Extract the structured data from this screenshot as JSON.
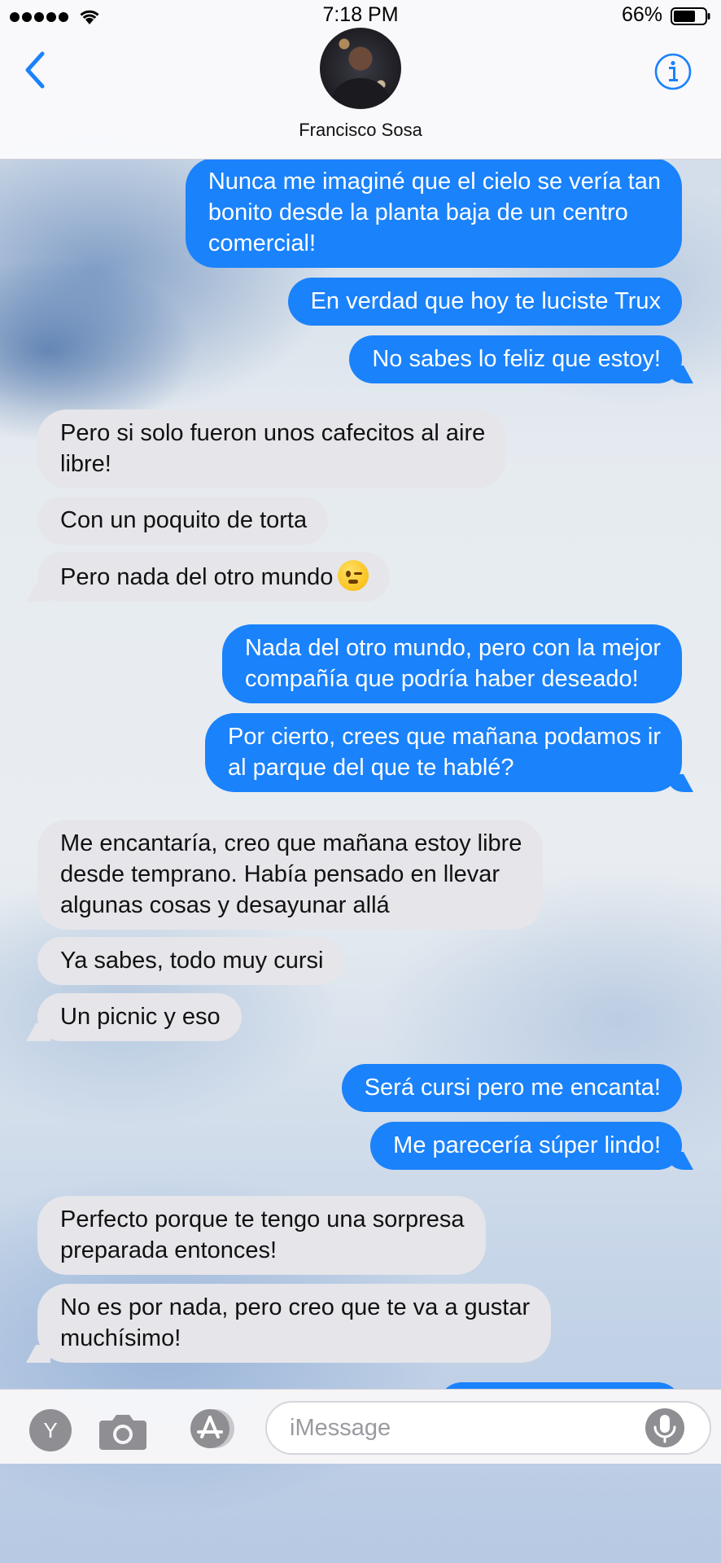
{
  "status_bar": {
    "time": "7:18 PM",
    "battery_percent": "66%",
    "icons": [
      "signal-dots",
      "wifi-icon",
      "battery-icon"
    ]
  },
  "header": {
    "contact_name": "Francisco Sosa",
    "icons": {
      "back": "chevron-left-icon",
      "info": "info-icon",
      "avatar": "contact-avatar"
    }
  },
  "colors": {
    "sent_bubble": "#1a82fb",
    "received_bubble": "#e5e5ea",
    "accent": "#1a82fb"
  },
  "messages": [
    {
      "direction": "sent",
      "lines": [
        "Nunca me imaginé que el cielo se vería tan",
        "bonito desde la planta baja de un centro",
        "comercial!"
      ]
    },
    {
      "direction": "sent",
      "lines": [
        "En verdad que hoy te luciste Trux"
      ]
    },
    {
      "direction": "sent",
      "lines": [
        "No sabes lo feliz que estoy!"
      ]
    },
    {
      "direction": "received",
      "lines": [
        "Pero si solo fueron unos cafecitos al aire",
        "libre!"
      ]
    },
    {
      "direction": "received",
      "lines": [
        "Con un poquito de torta"
      ]
    },
    {
      "direction": "received",
      "lines": [
        "Pero nada del otro mundo"
      ],
      "emoji": "winking-face"
    },
    {
      "direction": "sent",
      "lines": [
        "Nada del otro mundo, pero con la mejor",
        "compañía que podría haber deseado!"
      ]
    },
    {
      "direction": "sent",
      "lines": [
        "Por cierto, crees que mañana podamos ir",
        "al parque del que te hablé?"
      ]
    },
    {
      "direction": "received",
      "lines": [
        "Me encantaría, creo que mañana estoy libre",
        "desde temprano. Había pensado en llevar",
        "algunas cosas y desayunar allá"
      ]
    },
    {
      "direction": "received",
      "lines": [
        "Ya sabes, todo muy cursi"
      ]
    },
    {
      "direction": "received",
      "lines": [
        "Un picnic y eso"
      ]
    },
    {
      "direction": "sent",
      "lines": [
        "Será cursi pero me encanta!"
      ]
    },
    {
      "direction": "sent",
      "lines": [
        "Me parecería súper lindo!"
      ]
    },
    {
      "direction": "received",
      "lines": [
        "Perfecto porque te tengo una sorpresa",
        "preparada entonces!"
      ]
    },
    {
      "direction": "received",
      "lines": [
        "No es por nada, pero creo que te va a gustar",
        "muchísimo!"
      ]
    }
  ],
  "input_bar": {
    "app_button_letter": "Y",
    "placeholder": "iMessage",
    "value": "",
    "icons": {
      "camera": "camera-icon",
      "apps": "app-store-icon",
      "mic": "microphone-icon"
    }
  }
}
